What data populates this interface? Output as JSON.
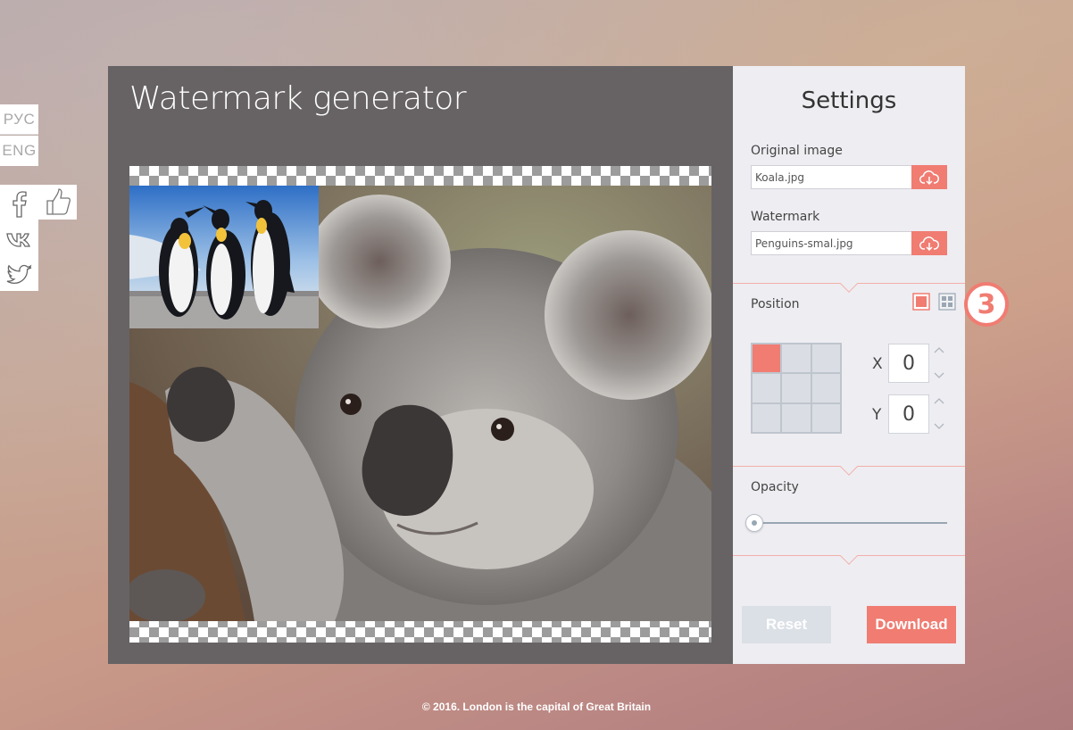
{
  "lang": {
    "ru": "РУС",
    "en": "ENG"
  },
  "social": {
    "icons": [
      "facebook-icon",
      "vk-icon",
      "twitter-icon",
      "like-icon"
    ]
  },
  "app": {
    "title": "Watermark generator"
  },
  "settings": {
    "title": "Settings",
    "original_label": "Original image",
    "original_file": "Koala.jpg",
    "watermark_label": "Watermark",
    "watermark_file": "Penguins-smal.jpg",
    "position_label": "Position",
    "step_badge": "3",
    "x_label": "X",
    "x_value": "0",
    "y_label": "Y",
    "y_value": "0",
    "opacity_label": "Opacity",
    "opacity_value": 0,
    "reset_label": "Reset",
    "download_label": "Download",
    "grid_selected": 0
  },
  "colors": {
    "accent": "#f07c72",
    "panel": "#676364",
    "settings_bg": "#eeedf2"
  },
  "footer": "© 2016. London is the capital of Great Britain"
}
